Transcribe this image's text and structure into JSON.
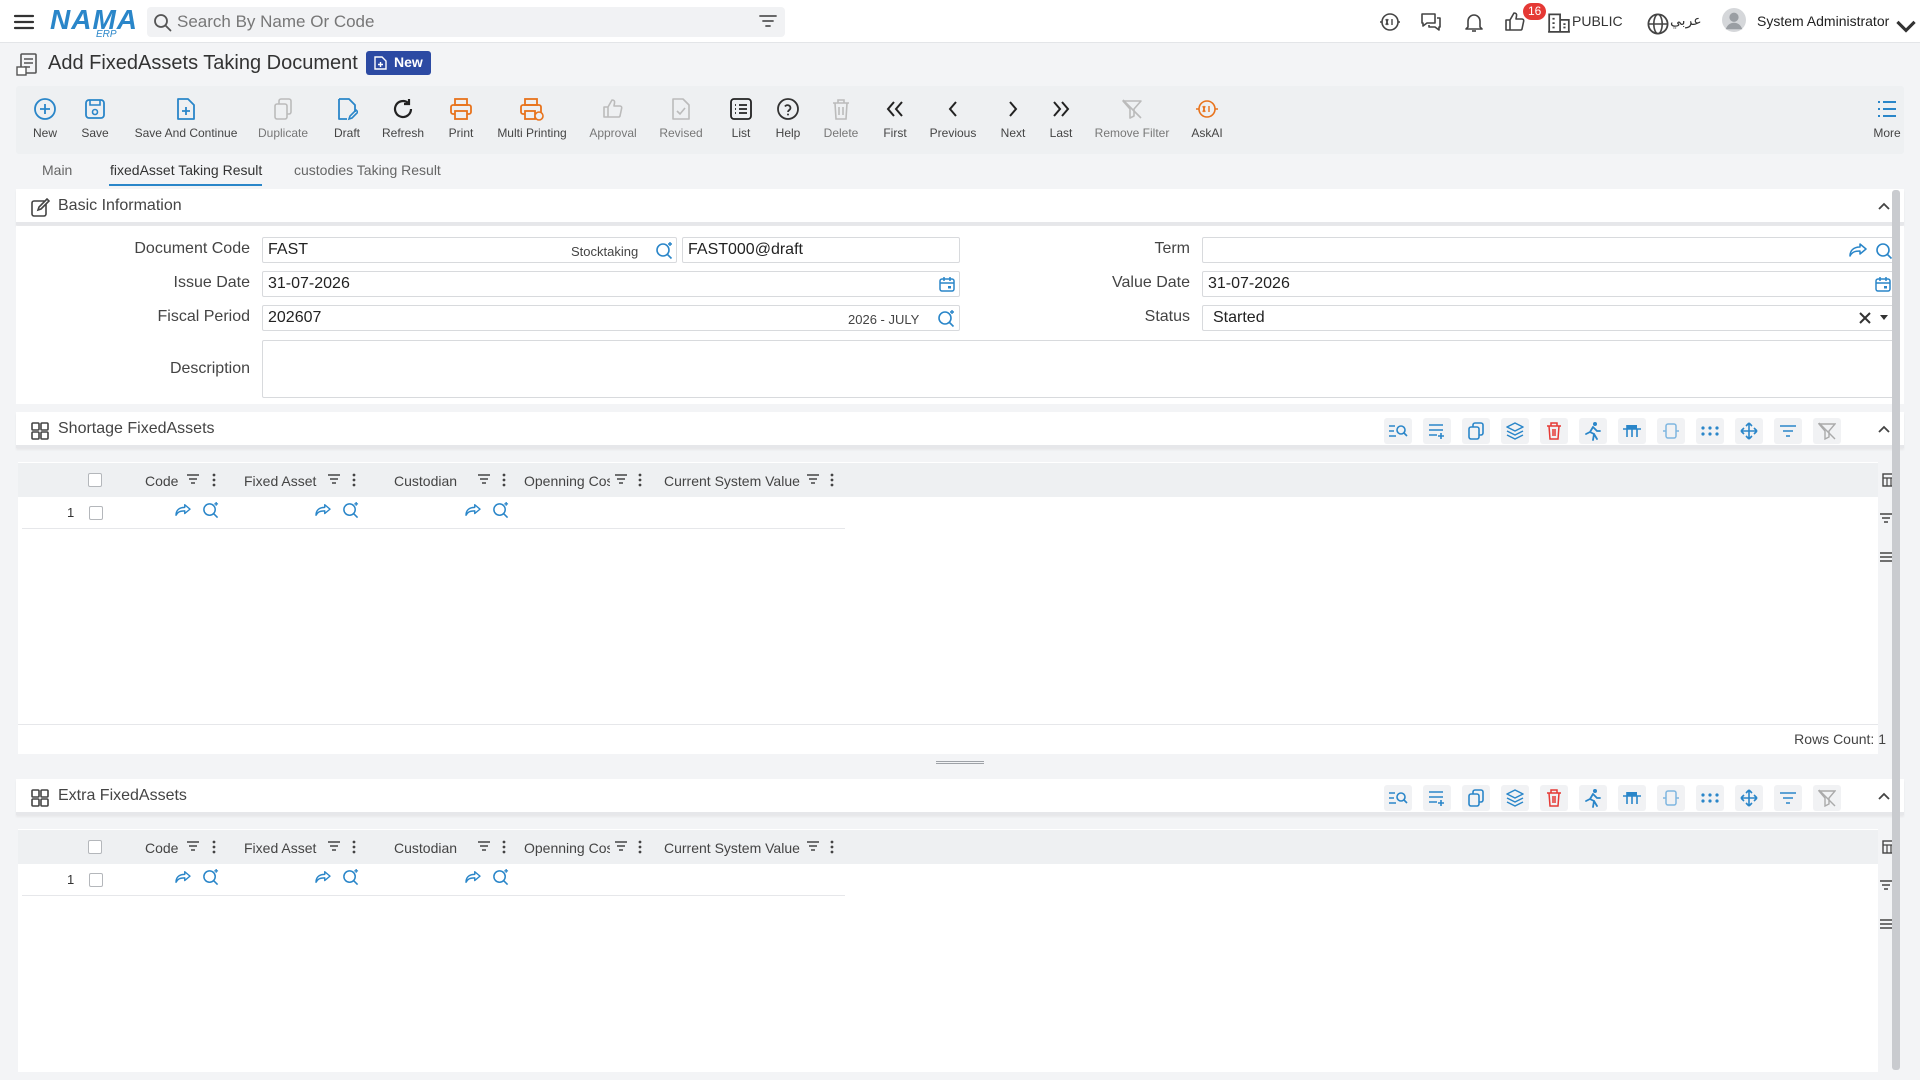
{
  "app": {
    "logo_text": "NAMA",
    "logo_sub": "ERP",
    "search_placeholder": "Search By Name Or Code",
    "notification_count": "16",
    "branch": "PUBLIC",
    "language": "عربي",
    "user": "System Administrator"
  },
  "page": {
    "title": "Add FixedAssets Taking Document",
    "status_badge": "New"
  },
  "toolbar": {
    "new": "New",
    "save": "Save",
    "save_continue": "Save And Continue",
    "duplicate": "Duplicate",
    "draft": "Draft",
    "refresh": "Refresh",
    "print": "Print",
    "multi_printing": "Multi Printing",
    "approval": "Approval",
    "revised": "Revised",
    "list": "List",
    "help": "Help",
    "delete": "Delete",
    "first": "First",
    "previous": "Previous",
    "next": "Next",
    "last": "Last",
    "remove_filter": "Remove Filter",
    "askai": "AskAI",
    "more": "More"
  },
  "tabs": [
    {
      "label": "Main"
    },
    {
      "label": "fixedAsset Taking Result",
      "active": true
    },
    {
      "label": "custodies Taking Result"
    }
  ],
  "basic_info": {
    "title": "Basic Information",
    "document_code_label": "Document Code",
    "document_code": "FAST",
    "document_code_tag": "Stocktaking",
    "document_code_full": "FAST000@draft",
    "issue_date_label": "Issue Date",
    "issue_date": "31-07-2026",
    "fiscal_period_label": "Fiscal Period",
    "fiscal_period": "202607",
    "fiscal_period_tag": "2026 - JULY",
    "description_label": "Description",
    "term_label": "Term",
    "term": "",
    "value_date_label": "Value Date",
    "value_date": "31-07-2026",
    "status_label": "Status",
    "status": "Started"
  },
  "grid_columns": [
    "Code",
    "Fixed Asset",
    "Custodian",
    "Openning Cos",
    "Current System Value"
  ],
  "shortage": {
    "title": "Shortage FixedAssets",
    "row_number": "1",
    "rows_count": "Rows Count: 1"
  },
  "extra": {
    "title": "Extra FixedAssets",
    "row_number": "1"
  },
  "colors": {
    "accent": "#2a86c9",
    "badge": "#2c4aa3",
    "print": "#e8731c",
    "danger": "#e53935"
  }
}
